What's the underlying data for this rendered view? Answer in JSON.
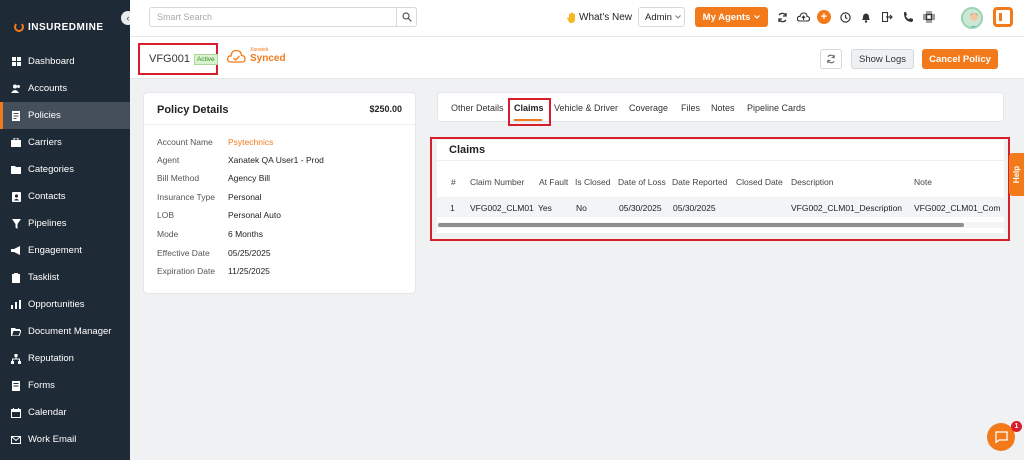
{
  "sidebar": {
    "brand": "INSUREDMINE",
    "items": [
      {
        "label": "Dashboard",
        "icon": "dashboard-icon",
        "active": false
      },
      {
        "label": "Accounts",
        "icon": "users-icon",
        "active": false
      },
      {
        "label": "Policies",
        "icon": "document-icon",
        "active": true
      },
      {
        "label": "Carriers",
        "icon": "briefcase-icon",
        "active": false
      },
      {
        "label": "Categories",
        "icon": "folder-icon",
        "active": false
      },
      {
        "label": "Contacts",
        "icon": "contact-card-icon",
        "active": false
      },
      {
        "label": "Pipelines",
        "icon": "funnel-icon",
        "active": false
      },
      {
        "label": "Engagement",
        "icon": "megaphone-icon",
        "active": false
      },
      {
        "label": "Tasklist",
        "icon": "clipboard-icon",
        "active": false
      },
      {
        "label": "Opportunities",
        "icon": "bar-chart-icon",
        "active": false
      },
      {
        "label": "Document Manager",
        "icon": "folder-open-icon",
        "active": false
      },
      {
        "label": "Reputation",
        "icon": "network-icon",
        "active": false
      },
      {
        "label": "Forms",
        "icon": "form-icon",
        "active": false
      },
      {
        "label": "Calendar",
        "icon": "calendar-icon",
        "active": false
      },
      {
        "label": "Work Email",
        "icon": "mail-icon",
        "active": false
      }
    ]
  },
  "header": {
    "search_placeholder": "Smart Search",
    "whats_new": "What's New",
    "role": "Admin",
    "my_agents": "My Agents"
  },
  "policy": {
    "id": "VFG001",
    "status": "Active",
    "sync_small": "Xanatek",
    "sync_label": "Synced",
    "show_logs": "Show Logs",
    "cancel_policy": "Cancel Policy"
  },
  "details": {
    "title": "Policy Details",
    "amount": "$250.00",
    "rows": [
      {
        "label": "Account Name",
        "value": "Psytechnics"
      },
      {
        "label": "Agent",
        "value": "Xanatek QA User1 - Prod"
      },
      {
        "label": "Bill Method",
        "value": "Agency Bill"
      },
      {
        "label": "Insurance Type",
        "value": "Personal"
      },
      {
        "label": "LOB",
        "value": "Personal Auto"
      },
      {
        "label": "Mode",
        "value": "6 Months"
      },
      {
        "label": "Effective Date",
        "value": "05/25/2025"
      },
      {
        "label": "Expiration Date",
        "value": "11/25/2025"
      }
    ]
  },
  "tabs": [
    "Other Details",
    "Claims",
    "Vehicle & Driver",
    "Coverage",
    "Files",
    "Notes",
    "Pipeline Cards"
  ],
  "active_tab": "Claims",
  "claims": {
    "title": "Claims",
    "columns": [
      "#",
      "Claim Number",
      "At Fault",
      "Is Closed",
      "Date of Loss",
      "Date Reported",
      "Closed Date",
      "Description",
      "Note"
    ],
    "rows": [
      [
        "1",
        "VFG002_CLM01",
        "Yes",
        "No",
        "05/30/2025",
        "05/30/2025",
        "",
        "VFG002_CLM01_Description",
        "VFG002_CLM01_Com"
      ]
    ]
  },
  "help": "Help",
  "chat_badge": "1",
  "colors": {
    "accent": "#f27a1a",
    "sidebar": "#1f2a37",
    "highlight": "#d81e2a"
  }
}
